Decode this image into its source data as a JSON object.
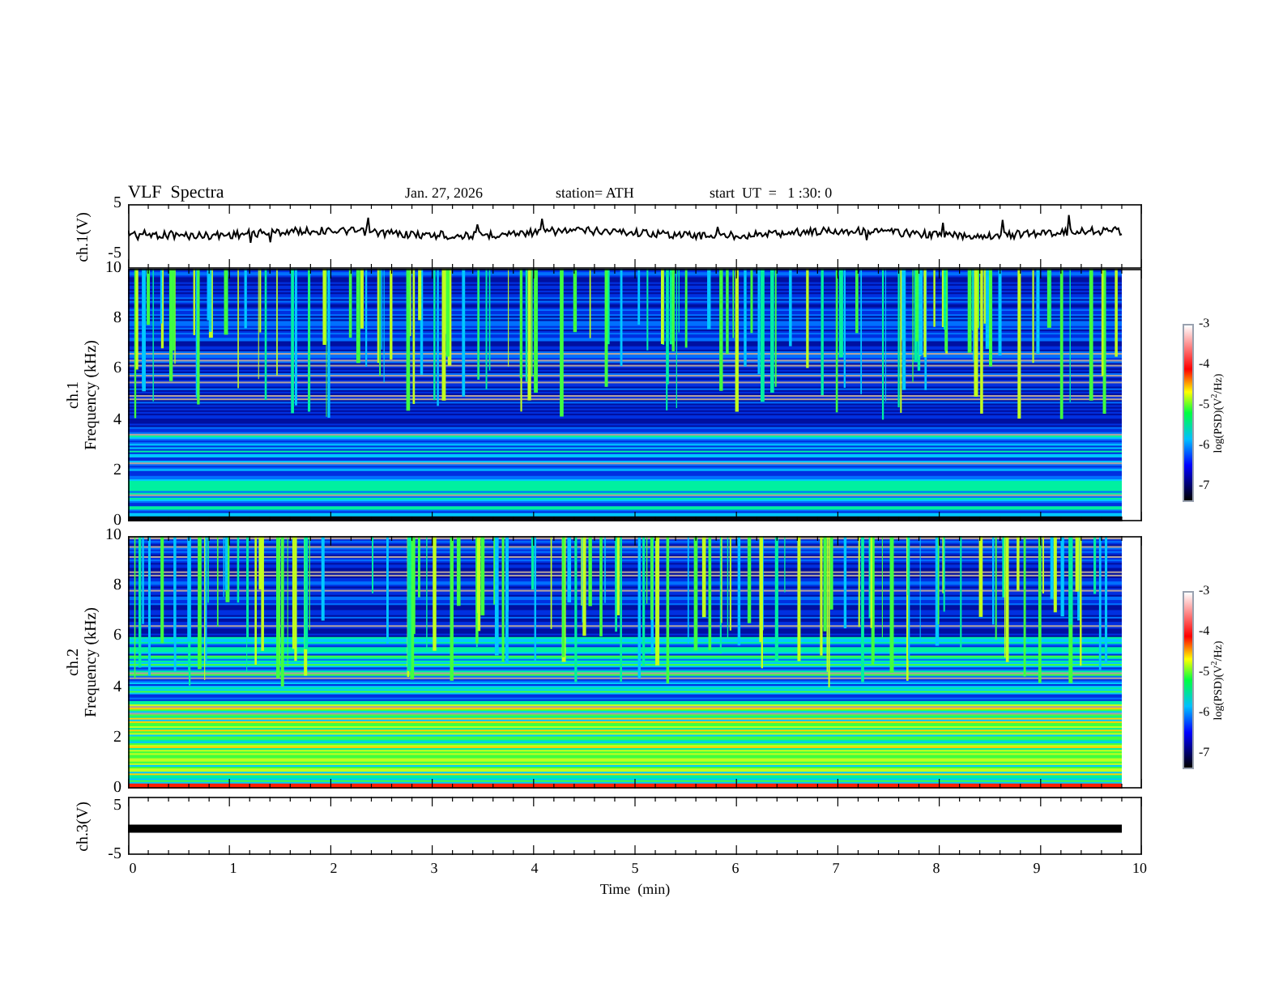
{
  "header": {
    "title": "VLF  Spectra",
    "date": "Jan. 27, 2026",
    "station": "station= ATH",
    "start": "start  UT  =   1 :30: 0"
  },
  "panels": [
    {
      "kind": "waveform",
      "ylabel": "ch.1(V)",
      "yticks": [
        "5",
        "-5"
      ]
    },
    {
      "kind": "spectrogram",
      "ylabel_top": "ch.1",
      "ylabel_bottom": "Frequency  (kHz)",
      "yticks": [
        "10",
        "8",
        "6",
        "4",
        "2",
        "0"
      ],
      "colorbar": {
        "label": "log(PSD)(V$^{2}$/Hz)",
        "ticks": [
          "-3",
          "-4",
          "-5",
          "-6",
          "-7"
        ]
      }
    },
    {
      "kind": "spectrogram",
      "ylabel_top": "ch.2",
      "ylabel_bottom": "Frequency  (kHz)",
      "yticks": [
        "10",
        "8",
        "6",
        "4",
        "2",
        "0"
      ],
      "colorbar": {
        "label": "log(PSD)(V$^{2}$/Hz)",
        "ticks": [
          "-3",
          "-4",
          "-5",
          "-6",
          "-7"
        ]
      }
    },
    {
      "kind": "level_trace",
      "ylabel": "ch.3(V)",
      "yticks": [
        "5",
        "-5"
      ]
    }
  ],
  "x_axis": {
    "ticks": [
      "0",
      "1",
      "2",
      "3",
      "4",
      "5",
      "6",
      "7",
      "8",
      "9",
      "10"
    ],
    "label": "Time  (min)"
  }
}
